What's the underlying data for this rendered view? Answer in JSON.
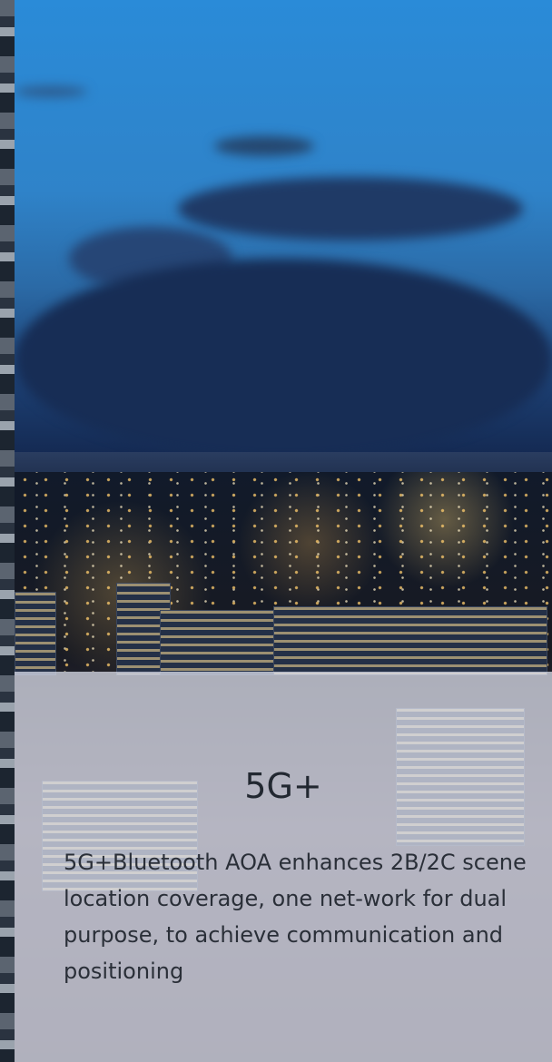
{
  "slide": {
    "title": "5G+",
    "description": "5G+Bluetooth AOA enhances 2B/2C scene location coverage, one net-work for dual purpose, to achieve communication and positioning"
  },
  "background": {
    "image_icon": "city-night-skyline-photo",
    "sky_color": "#2f83c9",
    "overlay_color": "#e4e8f4"
  }
}
